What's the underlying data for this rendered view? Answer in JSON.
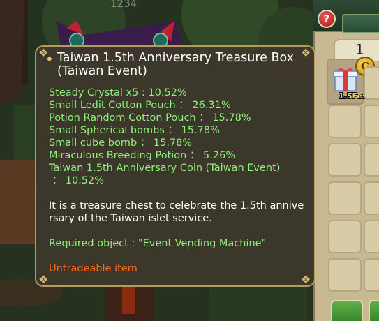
{
  "background": {
    "overhead_number": "1234"
  },
  "inventory": {
    "help_icon": "?",
    "item_count": "1",
    "slot_item": {
      "icon": "gift-box-icon",
      "badge": "C",
      "label": "1.5Fes"
    }
  },
  "tooltip": {
    "title": "Taiwan 1.5th Anniversary Treasure Box (Taiwan Event)",
    "drops": [
      "Steady Crystal x5 : 10.52%",
      "Small Ledit Cotton Pouch ： 26.31%",
      "Potion Random Cotton Pouch ： 15.78%",
      "Small Spherical bombs ： 15.78%",
      "Small cube bomb ： 15.78%",
      "Miraculous Breeding Potion ： 5.26%",
      "Taiwan 1.5th Anniversary Coin (Taiwan Event)",
      " ： 10.52%"
    ],
    "description": "It is a treasure chest to celebrate the 1.5th anniversary of the Taiwan islet service.",
    "required": "Required object : \"Event Vending Machine\"",
    "tradeable": "Untradeable item"
  },
  "colors": {
    "drop_text": "#8ff07a",
    "warning_text": "#ff6a1a",
    "tooltip_border": "#b59a62"
  }
}
